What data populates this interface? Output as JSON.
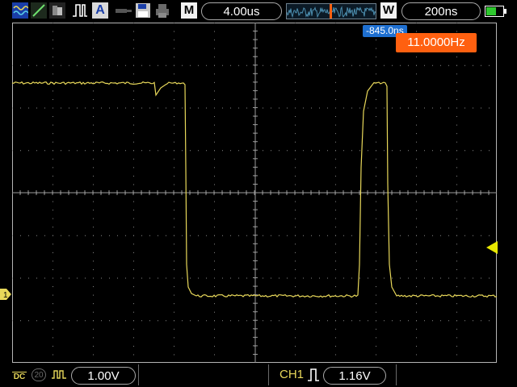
{
  "toolbar": {
    "mode_letter": "M",
    "timebase": "4.00us",
    "window_letter": "W",
    "window_timebase": "200ns",
    "icons": [
      "display-mode-icon",
      "cursor-line-icon",
      "persistence-icon",
      "pulse-icon",
      "auto-measure-icon",
      "probe-icon",
      "save-icon",
      "print-icon",
      "battery-icon"
    ],
    "auto_letter": "A"
  },
  "screen": {
    "delay_readout": "-845.0ns",
    "frequency_readout": "11.0000Hz",
    "channel_marker": "1"
  },
  "status": {
    "coupling": "DC",
    "bandwidth_limit": "20",
    "volts_per_div": "1.00V",
    "trigger_channel": "CH1",
    "trigger_level": "1.16V"
  },
  "colors": {
    "trace": "#e8d85a",
    "frequency_badge": "#ff6010",
    "delay_badge": "#1e6fd0",
    "graticule": "#8a8a8a"
  }
}
